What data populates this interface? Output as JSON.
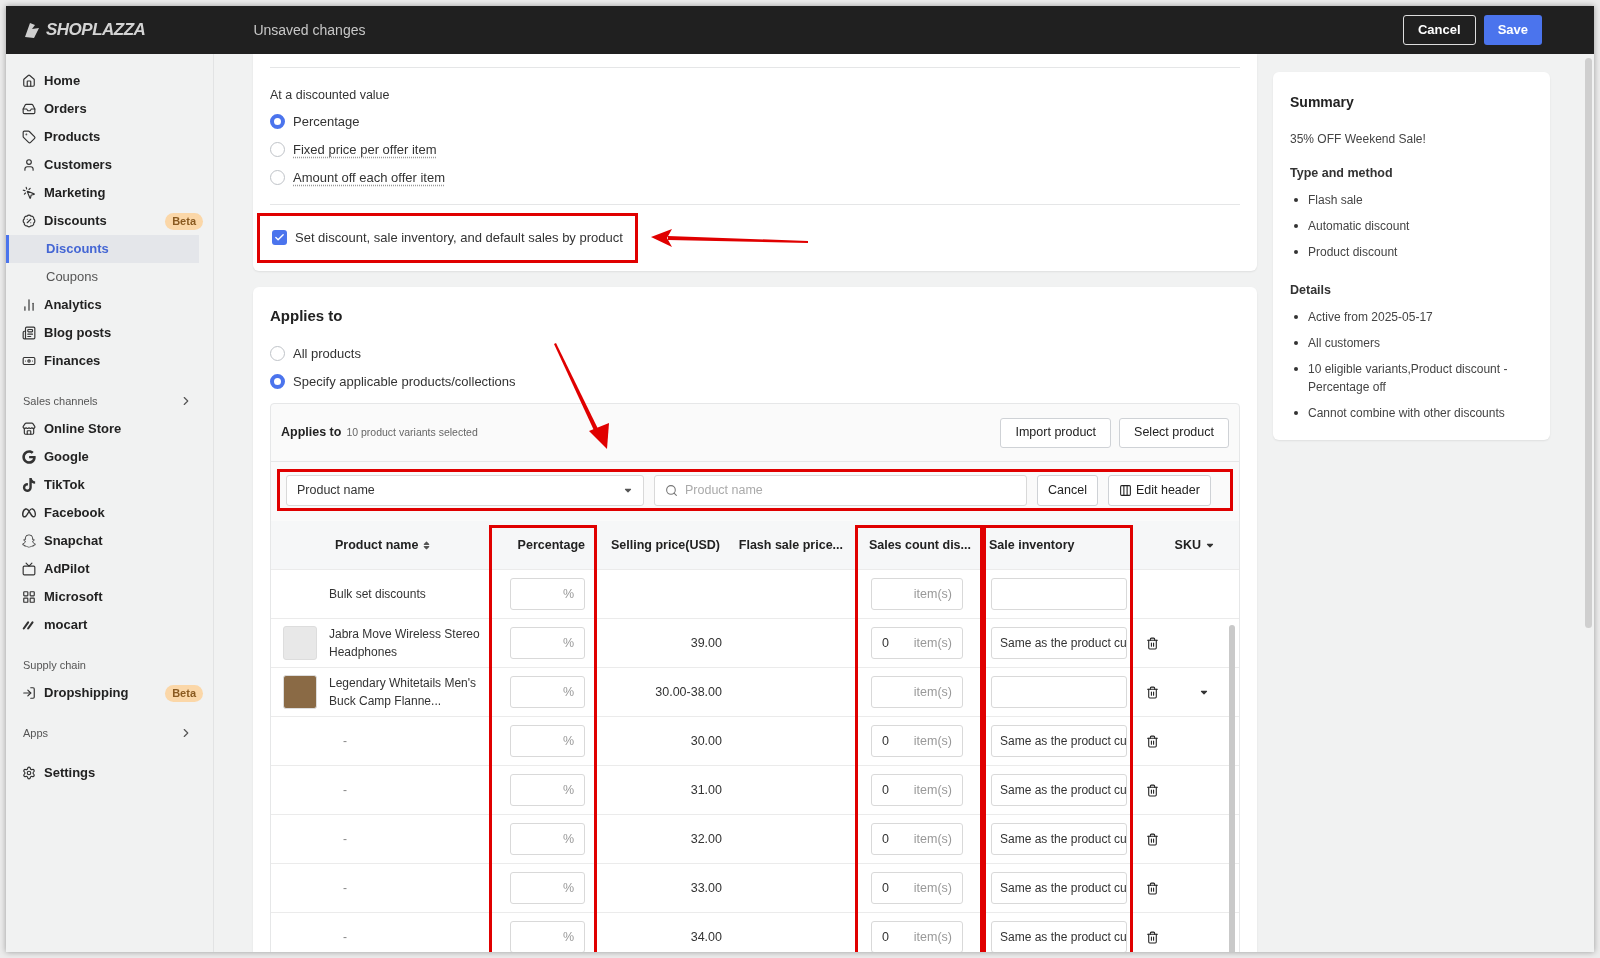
{
  "top_bar": {
    "brand": "SHOPLAZZA",
    "status": "Unsaved changes",
    "buttons": [
      {
        "label": "Cancel",
        "kind": "secondary"
      },
      {
        "label": "Save",
        "kind": "primary"
      }
    ]
  },
  "sidebar": {
    "sections": [
      {
        "items": [
          {
            "label": "Home",
            "selected": false
          },
          {
            "label": "Orders",
            "selected": false
          },
          {
            "label": "Products",
            "selected": false
          },
          {
            "label": "Customers",
            "selected": false
          },
          {
            "label": "Marketing",
            "selected": false
          },
          {
            "label": "Discounts",
            "selected": false,
            "badge": "Beta",
            "children": [
              {
                "label": "Discounts",
                "selected": true
              },
              {
                "label": "Coupons",
                "selected": false
              }
            ]
          },
          {
            "label": "Analytics",
            "selected": false
          },
          {
            "label": "Blog posts",
            "selected": false
          },
          {
            "label": "Finances",
            "selected": false
          }
        ]
      },
      {
        "heading": "Sales channels",
        "expandable": true,
        "items": [
          {
            "label": "Online Store",
            "selected": false
          },
          {
            "label": "Google",
            "selected": false
          },
          {
            "label": "TikTok",
            "selected": false
          },
          {
            "label": "Facebook",
            "selected": false
          },
          {
            "label": "Snapchat",
            "selected": false
          },
          {
            "label": "AdPilot",
            "selected": false
          },
          {
            "label": "Microsoft",
            "selected": false
          },
          {
            "label": "mocart",
            "selected": false
          }
        ]
      },
      {
        "heading": "Supply chain",
        "items": [
          {
            "label": "Dropshipping",
            "selected": false,
            "badge": "Beta"
          }
        ]
      },
      {
        "heading": "Apps",
        "expandable": true
      },
      {
        "items": [
          {
            "label": "Settings",
            "selected": false
          }
        ]
      }
    ]
  },
  "value_card": {
    "label": "At a discounted value",
    "options": [
      {
        "label": "Percentage",
        "selected": true,
        "hint": false
      },
      {
        "label": "Fixed price per offer item",
        "selected": false,
        "hint": true
      },
      {
        "label": "Amount off each offer item",
        "selected": false,
        "hint": true
      }
    ],
    "checkbox": {
      "label": "Set discount, sale inventory, and default sales by product",
      "checked": true,
      "highlighted": true,
      "arrow": true
    }
  },
  "applies_card": {
    "title": "Applies to",
    "options": [
      {
        "label": "All products",
        "selected": false,
        "hint": false
      },
      {
        "label": "Specify applicable products/collections",
        "selected": true,
        "hint": false
      }
    ],
    "arrow": true,
    "panel": {
      "title": "Applies to",
      "subtitle": "10 product variants selected",
      "buttons": [
        "Import product",
        "Select product"
      ],
      "filter": {
        "highlighted": true,
        "field": "Product name",
        "search_placeholder": "Product name",
        "buttons": [
          {
            "label": "Cancel",
            "kind": "plain"
          },
          {
            "label": "Edit header",
            "kind": "columns"
          }
        ]
      },
      "table": {
        "columns": [
          {
            "label": "Product name",
            "sort": true,
            "dropdown": false,
            "highlighted": false
          },
          {
            "label": "Percentage",
            "sort": false,
            "dropdown": false,
            "highlighted": true
          },
          {
            "label": "Selling price(USD)",
            "sort": false,
            "dropdown": false,
            "highlighted": false
          },
          {
            "label": "Flash sale price...",
            "sort": false,
            "dropdown": false,
            "highlighted": false
          },
          {
            "label": "Sales count dis...",
            "sort": false,
            "dropdown": false,
            "highlighted": true
          },
          {
            "label": "Sale inventory",
            "sort": false,
            "dropdown": false,
            "highlighted": true
          },
          {
            "label": "SKU",
            "sort": false,
            "dropdown": true,
            "highlighted": false
          }
        ],
        "rows": [
          {
            "kind": "bulk",
            "name": "Bulk set discounts",
            "percent_unit": "%",
            "count_unit": "item(s)",
            "deletable": false,
            "sku_dropdown": false
          },
          {
            "kind": "product",
            "name": "Jabra Move Wireless Stereo Headphones",
            "percent_unit": "%",
            "price": "39.00",
            "sales_count": "0",
            "count_unit": "item(s)",
            "inventory": "Same as the product cu",
            "deletable": true,
            "sku_dropdown": false
          },
          {
            "kind": "product",
            "name": "Legendary Whitetails Men's Buck Camp Flanne...",
            "percent_unit": "%",
            "price": "30.00-38.00",
            "count_unit": "item(s)",
            "deletable": true,
            "sku_dropdown": true
          },
          {
            "kind": "variant",
            "name": "-",
            "percent_unit": "%",
            "price": "30.00",
            "sales_count": "0",
            "count_unit": "item(s)",
            "inventory": "Same as the product cu",
            "deletable": true,
            "sku_dropdown": false
          },
          {
            "kind": "variant",
            "name": "-",
            "percent_unit": "%",
            "price": "31.00",
            "sales_count": "0",
            "count_unit": "item(s)",
            "inventory": "Same as the product cu",
            "deletable": true,
            "sku_dropdown": false
          },
          {
            "kind": "variant",
            "name": "-",
            "percent_unit": "%",
            "price": "32.00",
            "sales_count": "0",
            "count_unit": "item(s)",
            "inventory": "Same as the product cu",
            "deletable": true,
            "sku_dropdown": false
          },
          {
            "kind": "variant",
            "name": "-",
            "percent_unit": "%",
            "price": "33.00",
            "sales_count": "0",
            "count_unit": "item(s)",
            "inventory": "Same as the product cu",
            "deletable": true,
            "sku_dropdown": false
          },
          {
            "kind": "variant",
            "name": "-",
            "percent_unit": "%",
            "price": "34.00",
            "sales_count": "0",
            "count_unit": "item(s)",
            "inventory": "Same as the product cu",
            "deletable": true,
            "sku_dropdown": false
          }
        ]
      }
    }
  },
  "summary": {
    "title": "Summary",
    "name": "35% OFF Weekend Sale!",
    "groups": [
      {
        "heading": "Type and method",
        "items": [
          "Flash sale",
          "Automatic discount",
          "Product discount"
        ]
      },
      {
        "heading": "Details",
        "items": [
          "Active from 2025-05-17",
          "All customers",
          "10 eligible variants,Product discount - Percentage off",
          "Cannot combine with other discounts"
        ]
      }
    ]
  }
}
